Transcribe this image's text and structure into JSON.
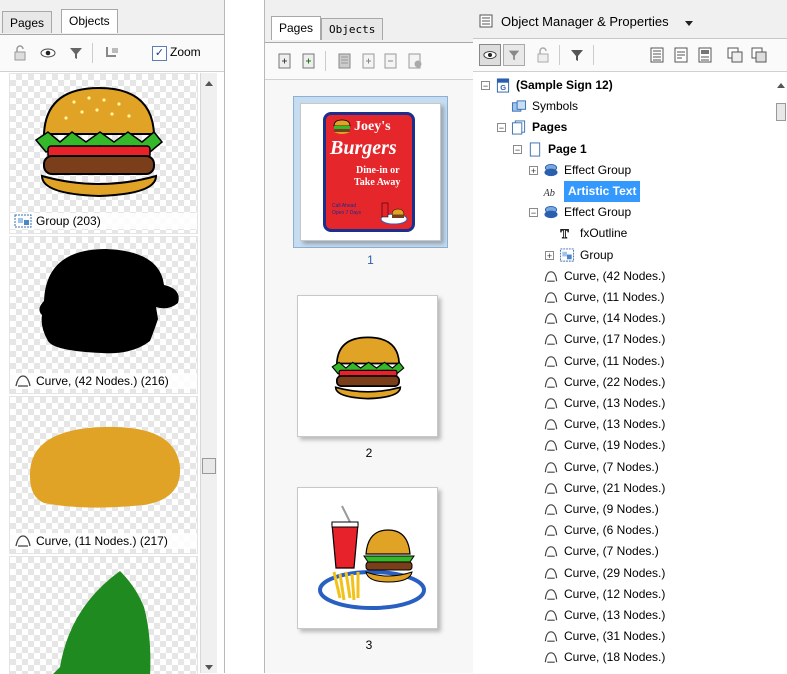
{
  "left_panel": {
    "tabs": [
      "Pages",
      "Objects"
    ],
    "zoom_label": "Zoom",
    "zoom_checked": true,
    "items": [
      {
        "label": "Group (203)",
        "icon": "group-icon"
      },
      {
        "label": "Curve, (42 Nodes.) (216)",
        "icon": "curve-icon"
      },
      {
        "label": "Curve, (11 Nodes.) (217)",
        "icon": "curve-icon"
      },
      {
        "label": "",
        "icon": "curve-icon"
      }
    ]
  },
  "middle_panel": {
    "tabs": [
      "Pages",
      "Objects"
    ],
    "pages": [
      {
        "number": "1",
        "selected": true,
        "sign": {
          "line1": "Joey's",
          "line2": "Burgers",
          "line3": "Dine-in or",
          "line4": "Take Away",
          "line5": "Call Ahead",
          "line6": "Open 7 Days"
        }
      },
      {
        "number": "2",
        "selected": false
      },
      {
        "number": "3",
        "selected": false
      }
    ]
  },
  "right_panel": {
    "title": "Object Manager & Properties",
    "tree": [
      {
        "label": "(Sample Sign 12)",
        "bold": true,
        "indent": 0,
        "expander": "minus",
        "icon": "document-icon"
      },
      {
        "label": "Symbols",
        "bold": false,
        "indent": 1,
        "expander": "",
        "icon": "symbols-icon"
      },
      {
        "label": "Pages",
        "bold": true,
        "indent": 1,
        "expander": "minus",
        "icon": "pages-icon"
      },
      {
        "label": "Page 1",
        "bold": true,
        "indent": 2,
        "expander": "minus",
        "icon": "page-icon"
      },
      {
        "label": "Effect Group",
        "bold": false,
        "indent": 3,
        "expander": "plus",
        "icon": "effect-group-icon"
      },
      {
        "label": "Artistic Text",
        "bold": false,
        "indent": 3,
        "expander": "",
        "icon": "artistic-text-icon",
        "selected": true
      },
      {
        "label": "Effect Group",
        "bold": false,
        "indent": 3,
        "expander": "minus",
        "icon": "effect-group-icon"
      },
      {
        "label": "fxOutline",
        "bold": false,
        "indent": 4,
        "expander": "",
        "icon": "fx-outline-icon"
      },
      {
        "label": "Group",
        "bold": false,
        "indent": 4,
        "expander": "plus",
        "icon": "group-icon"
      },
      {
        "label": "Curve, (42 Nodes.)",
        "bold": false,
        "indent": 3,
        "expander": "",
        "icon": "curve-icon"
      },
      {
        "label": "Curve, (11 Nodes.)",
        "bold": false,
        "indent": 3,
        "expander": "",
        "icon": "curve-icon"
      },
      {
        "label": "Curve, (14 Nodes.)",
        "bold": false,
        "indent": 3,
        "expander": "",
        "icon": "curve-icon"
      },
      {
        "label": "Curve, (17 Nodes.)",
        "bold": false,
        "indent": 3,
        "expander": "",
        "icon": "curve-icon"
      },
      {
        "label": "Curve, (11 Nodes.)",
        "bold": false,
        "indent": 3,
        "expander": "",
        "icon": "curve-icon"
      },
      {
        "label": "Curve, (22 Nodes.)",
        "bold": false,
        "indent": 3,
        "expander": "",
        "icon": "curve-icon"
      },
      {
        "label": "Curve, (13 Nodes.)",
        "bold": false,
        "indent": 3,
        "expander": "",
        "icon": "curve-icon"
      },
      {
        "label": "Curve, (13 Nodes.)",
        "bold": false,
        "indent": 3,
        "expander": "",
        "icon": "curve-icon"
      },
      {
        "label": "Curve, (19 Nodes.)",
        "bold": false,
        "indent": 3,
        "expander": "",
        "icon": "curve-icon"
      },
      {
        "label": "Curve, (7 Nodes.)",
        "bold": false,
        "indent": 3,
        "expander": "",
        "icon": "curve-icon"
      },
      {
        "label": "Curve, (21 Nodes.)",
        "bold": false,
        "indent": 3,
        "expander": "",
        "icon": "curve-icon"
      },
      {
        "label": "Curve, (9 Nodes.)",
        "bold": false,
        "indent": 3,
        "expander": "",
        "icon": "curve-icon"
      },
      {
        "label": "Curve, (6 Nodes.)",
        "bold": false,
        "indent": 3,
        "expander": "",
        "icon": "curve-icon"
      },
      {
        "label": "Curve, (7 Nodes.)",
        "bold": false,
        "indent": 3,
        "expander": "",
        "icon": "curve-icon"
      },
      {
        "label": "Curve, (29 Nodes.)",
        "bold": false,
        "indent": 3,
        "expander": "",
        "icon": "curve-icon"
      },
      {
        "label": "Curve, (12 Nodes.)",
        "bold": false,
        "indent": 3,
        "expander": "",
        "icon": "curve-icon"
      },
      {
        "label": "Curve, (13 Nodes.)",
        "bold": false,
        "indent": 3,
        "expander": "",
        "icon": "curve-icon"
      },
      {
        "label": "Curve, (31 Nodes.)",
        "bold": false,
        "indent": 3,
        "expander": "",
        "icon": "curve-icon"
      },
      {
        "label": "Curve, (18 Nodes.)",
        "bold": false,
        "indent": 3,
        "expander": "",
        "icon": "curve-icon"
      }
    ]
  },
  "colors": {
    "selection": "#3399ff",
    "bun": "#e0a326",
    "lettuce": "#2e8b1f",
    "sign_red": "#e5262b"
  }
}
